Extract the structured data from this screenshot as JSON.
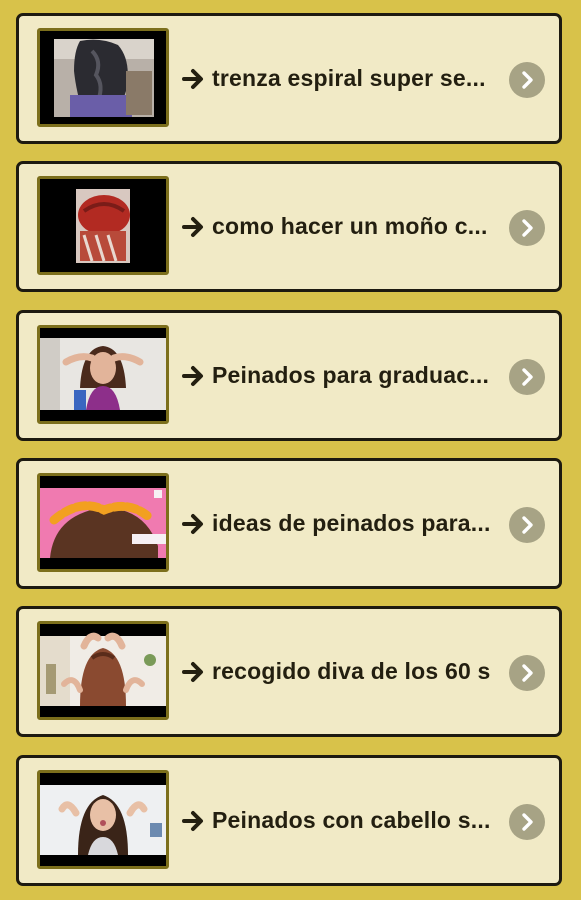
{
  "video_list": {
    "items": [
      {
        "title": "trenza espiral super se...",
        "thumbnail": "braid-thumbnail"
      },
      {
        "title": "como hacer un moño c...",
        "thumbnail": "bun-thumbnail"
      },
      {
        "title": "Peinados para graduac...",
        "thumbnail": "woman-hair-thumbnail"
      },
      {
        "title": "ideas de peinados para...",
        "thumbnail": "braided-crown-thumbnail"
      },
      {
        "title": "recogido diva de los 60 s",
        "thumbnail": "updo-thumbnail"
      },
      {
        "title": "Peinados con cabello s...",
        "thumbnail": "woman-hair-thumbnail"
      }
    ],
    "item_prefix_icon": "right-arrow-icon",
    "item_action_icon": "chevron-right-icon"
  },
  "colors": {
    "background": "#d8c24a",
    "card": "#f1eac6",
    "card_border": "#1d1a10",
    "thumb_border": "#7c6f1c",
    "chevron_circle": "#a7a385",
    "text": "#231f10"
  }
}
